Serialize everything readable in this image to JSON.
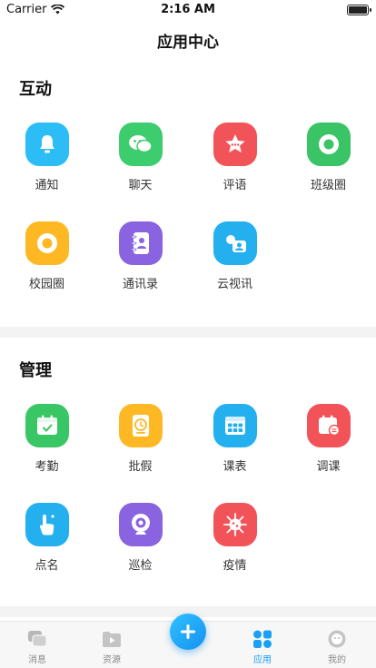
{
  "status_bar": {
    "carrier": "Carrier",
    "time": "2:16 AM"
  },
  "nav": {
    "title": "应用中心"
  },
  "sections": [
    {
      "title": "互动",
      "items": [
        {
          "label": "通知",
          "icon": "bell-icon",
          "color": "#2cbdf7"
        },
        {
          "label": "聊天",
          "icon": "chat-icon",
          "color": "#3dcc6e"
        },
        {
          "label": "评语",
          "icon": "star-comment-icon",
          "color": "#f25359"
        },
        {
          "label": "班级圈",
          "icon": "ring-icon",
          "color": "#3bc466"
        },
        {
          "label": "校园圈",
          "icon": "ring-icon",
          "color": "#fdb824"
        },
        {
          "label": "通讯录",
          "icon": "contacts-book-icon",
          "color": "#8a63e0"
        },
        {
          "label": "云视讯",
          "icon": "video-contact-icon",
          "color": "#24b0ef"
        }
      ]
    },
    {
      "title": "管理",
      "items": [
        {
          "label": "考勤",
          "icon": "calendar-check-icon",
          "color": "#38c764"
        },
        {
          "label": "批假",
          "icon": "clock-leave-icon",
          "color": "#fdb824"
        },
        {
          "label": "课表",
          "icon": "timetable-icon",
          "color": "#24b0ef"
        },
        {
          "label": "调课",
          "icon": "calendar-swap-icon",
          "color": "#f25359"
        },
        {
          "label": "点名",
          "icon": "hand-point-icon",
          "color": "#24b0ef"
        },
        {
          "label": "巡检",
          "icon": "camera-icon",
          "color": "#8a63e0"
        },
        {
          "label": "疫情",
          "icon": "virus-icon",
          "color": "#f25359"
        }
      ]
    }
  ],
  "tab_bar": {
    "items": [
      {
        "label": "消息",
        "icon": "message-icon",
        "active": false
      },
      {
        "label": "资源",
        "icon": "folder-play-icon",
        "active": false
      },
      {
        "label": "应用",
        "icon": "apps-icon",
        "active": true
      },
      {
        "label": "我的",
        "icon": "profile-icon",
        "active": false
      }
    ],
    "add_icon": "plus-icon",
    "accent": "#1aa0f5"
  }
}
